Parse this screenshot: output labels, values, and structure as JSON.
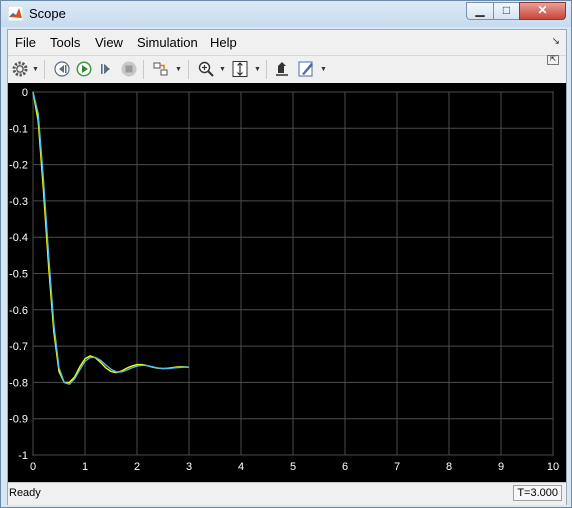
{
  "window": {
    "title": "Scope"
  },
  "titlebar_buttons": {
    "minimize": "▁",
    "maximize": "□",
    "close": "✕"
  },
  "menu": [
    "File",
    "Tools",
    "View",
    "Simulation",
    "Help"
  ],
  "toolbar_icons": [
    "gear-icon",
    "step-back-icon",
    "run-icon",
    "step-forward-icon",
    "stop-icon",
    "highlight-block-icon",
    "zoom-in-icon",
    "scale-axes-icon",
    "restore-view-icon",
    "style-icon"
  ],
  "status": {
    "text": "Ready",
    "time": "T=3.000"
  },
  "colors": {
    "plot_bg": "#000000",
    "grid": "#4d4d4d",
    "series1": "#ffff00",
    "series2": "#4dbeee",
    "axis_text": "#ffffff"
  },
  "chart_data": {
    "type": "line",
    "title": "",
    "xlabel": "",
    "ylabel": "",
    "xlim": [
      0,
      10
    ],
    "ylim": [
      -1,
      0
    ],
    "xticks": [
      "0",
      "1",
      "2",
      "3",
      "4",
      "5",
      "6",
      "7",
      "8",
      "9",
      "10"
    ],
    "yticks": [
      "0",
      "-0.1",
      "-0.2",
      "-0.3",
      "-0.4",
      "-0.5",
      "-0.6",
      "-0.7",
      "-0.8",
      "-0.9",
      "-1"
    ],
    "grid": true,
    "series": [
      {
        "x": [
          0,
          0.1,
          0.2,
          0.3,
          0.4,
          0.5,
          0.6,
          0.7,
          0.8,
          0.9,
          1.0,
          1.1,
          1.2,
          1.3,
          1.4,
          1.5,
          1.6,
          1.7,
          1.8,
          1.9,
          2.0,
          2.1,
          2.2,
          2.3,
          2.4,
          2.5,
          2.6,
          2.7,
          2.8,
          2.9,
          3.0
        ],
        "values": [
          0,
          -0.08,
          -0.27,
          -0.48,
          -0.66,
          -0.77,
          -0.8,
          -0.8,
          -0.785,
          -0.757,
          -0.735,
          -0.727,
          -0.732,
          -0.745,
          -0.76,
          -0.77,
          -0.773,
          -0.769,
          -0.761,
          -0.755,
          -0.751,
          -0.751,
          -0.754,
          -0.758,
          -0.761,
          -0.762,
          -0.761,
          -0.759,
          -0.757,
          -0.757,
          -0.758
        ]
      },
      {
        "x": [
          0,
          0.1,
          0.2,
          0.3,
          0.4,
          0.5,
          0.6,
          0.7,
          0.8,
          0.9,
          1.0,
          1.1,
          1.2,
          1.3,
          1.4,
          1.5,
          1.6,
          1.7,
          1.8,
          1.9,
          2.0,
          2.1,
          2.2,
          2.3,
          2.4,
          2.5,
          2.6,
          2.7,
          2.8,
          2.9,
          3.0
        ],
        "values": [
          0,
          -0.06,
          -0.24,
          -0.45,
          -0.64,
          -0.76,
          -0.8,
          -0.805,
          -0.79,
          -0.765,
          -0.742,
          -0.731,
          -0.731,
          -0.739,
          -0.752,
          -0.764,
          -0.771,
          -0.771,
          -0.766,
          -0.76,
          -0.755,
          -0.753,
          -0.754,
          -0.757,
          -0.76,
          -0.762,
          -0.762,
          -0.76,
          -0.759,
          -0.758,
          -0.758
        ]
      }
    ]
  }
}
